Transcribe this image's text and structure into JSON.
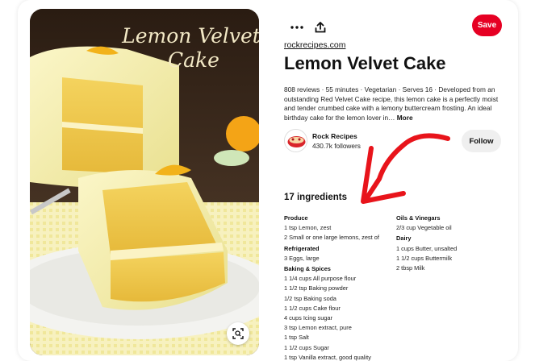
{
  "pin": {
    "image_overlay_title_line1": "Lemon Velvet",
    "image_overlay_title_line2": "Cake",
    "source": "rockrecipes.com",
    "title": "Lemon Velvet Cake",
    "description": "808 reviews · 55 minutes · Vegetarian · Serves 16 · Developed from an outstanding Red Velvet Cake recipe, this lemon cake is a perfectly moist and tender crumbed cake with a lemony buttercream frosting. An ideal birthday cake for the lemon lover in…",
    "more_label": "More"
  },
  "actions": {
    "more_icon": "more-horizontal-icon",
    "share_icon": "share-upload-icon",
    "save_label": "Save",
    "lens_icon": "visual-search-icon"
  },
  "creator": {
    "name": "Rock Recipes",
    "followers": "430.7k followers",
    "follow_label": "Follow"
  },
  "ingredients": {
    "heading": "17 ingredients",
    "left_groups": [
      {
        "title": "Produce",
        "items": [
          "1 tsp Lemon, zest",
          "2 Small or one large lemons, zest of"
        ]
      },
      {
        "title": "Refrigerated",
        "items": [
          "3 Eggs, large"
        ]
      },
      {
        "title": "Baking & Spices",
        "items": [
          "1 1/4 cups All purpose flour",
          "1 1/2 tsp Baking powder",
          "1/2 tsp Baking soda",
          "1 1/2 cups Cake flour",
          "4 cups Icing sugar",
          "3 tsp Lemon extract, pure",
          "1 tsp Salt",
          "1 1/2 cups Sugar",
          "1 tsp Vanilla extract, good quality"
        ]
      }
    ],
    "right_groups": [
      {
        "title": "Oils & Vinegars",
        "items": [
          "2/3 cup Vegetable oil"
        ]
      },
      {
        "title": "Dairy",
        "items": [
          "1 cups Butter, unsalted",
          "1 1/2 cups Buttermilk",
          "2 tbsp Milk"
        ]
      }
    ]
  },
  "colors": {
    "save_red": "#e60023",
    "annotation_red": "#e8141b",
    "follow_gray": "#efefef"
  }
}
